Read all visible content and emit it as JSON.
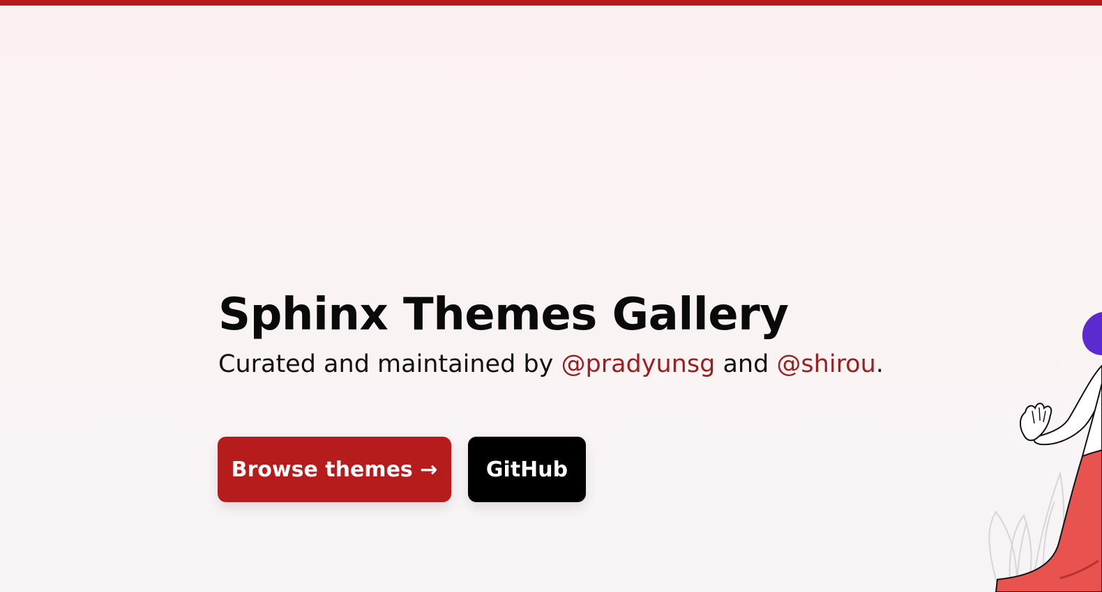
{
  "hero": {
    "title": "Sphinx Themes Gallery",
    "subtitle_prefix": "Curated and maintained by ",
    "maintainer_one": "@pradyunsg",
    "subtitle_and": " and ",
    "maintainer_two": "@shirou",
    "subtitle_suffix": "."
  },
  "actions": {
    "browse_label": "Browse themes →",
    "github_label": "GitHub"
  },
  "colors": {
    "accent": "#b71c1c",
    "link": "#9a1f1f",
    "dark_button": "#000000",
    "background": "#fcf1f1"
  },
  "illustration": {
    "icon": "waving-person-illustration"
  }
}
